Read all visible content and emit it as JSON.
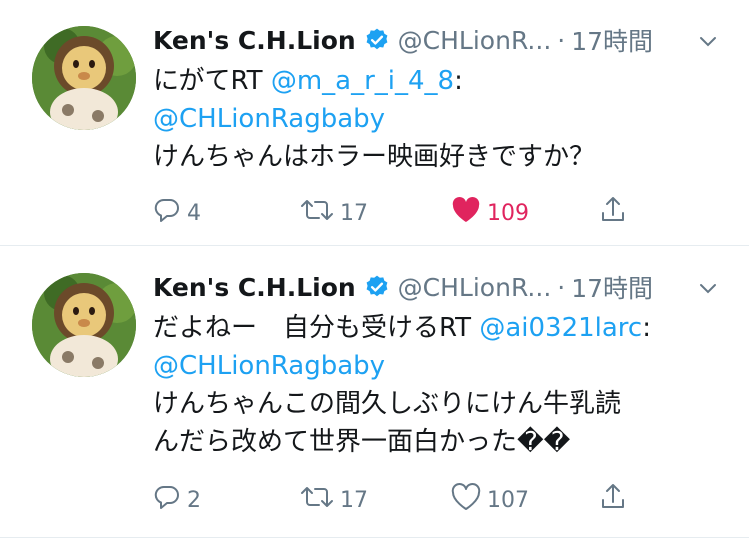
{
  "tweets": [
    {
      "author_name": "Ken's C.H.Lion",
      "handle": "@CHLionR...",
      "separator": "·",
      "time": "17時間",
      "line1_text": "にがてRT ",
      "line1_mention": "@m_a_r_i_4_8",
      "line1_suffix": ":",
      "line2_mention": "@CHLionRagbaby",
      "line3_text": "けんちゃんはホラー映画好きですか？",
      "reply_count": "4",
      "retweet_count": "17",
      "like_count": "109",
      "liked": true
    },
    {
      "author_name": "Ken's C.H.Lion",
      "handle": "@CHLionR...",
      "separator": "·",
      "time": "17時間",
      "line1_text": "だよねー　自分も受けるRT ",
      "line1_mention": "@ai0321larc",
      "line1_suffix": ":",
      "line2_mention": "@CHLionRagbaby",
      "line3_text": "けんちゃんこの間久しぶりにけん牛乳読",
      "line4_text": "んだら改めて世界一面白かった��",
      "reply_count": "2",
      "retweet_count": "17",
      "like_count": "107",
      "liked": false
    }
  ],
  "colors": {
    "link": "#1da1f2",
    "secondary_text": "#657786",
    "like_active": "#e0245e",
    "verified": "#1da1f2"
  },
  "icons": [
    "avatar-lion",
    "verified-badge-icon",
    "chevron-down-icon",
    "reply-icon",
    "retweet-icon",
    "heart-icon",
    "share-icon"
  ]
}
